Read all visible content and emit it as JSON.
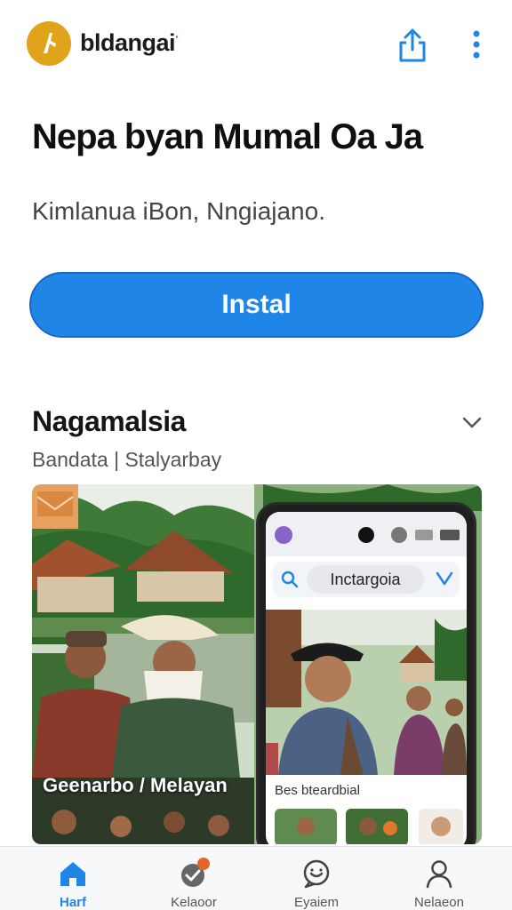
{
  "header": {
    "brand": "bldangai",
    "brand_mark": "·",
    "logo_icon": "app-logo-icon",
    "share_icon": "share-icon",
    "more_icon": "more-vertical-icon"
  },
  "app": {
    "title": "Nepa byan Mumal Oa Ja",
    "subtitle": "Kimlanua iBon, Nngiajano.",
    "install_label": "Instal"
  },
  "section": {
    "title": "Nagamalsia",
    "subtitle": "Bandata | Stalyarbay",
    "chevron_icon": "chevron-down-icon"
  },
  "gallery": {
    "caption": "Geenarbo / Melayan",
    "phone": {
      "search_text": "Inctargoia",
      "label": "Bes bteardbial"
    }
  },
  "nav": {
    "items": [
      {
        "label": "Harf",
        "icon": "home-icon",
        "active": true
      },
      {
        "label": "Kelaoor",
        "icon": "updates-icon",
        "active": false
      },
      {
        "label": "Eyaiem",
        "icon": "chat-icon",
        "active": false
      },
      {
        "label": "Nelaeon",
        "icon": "profile-icon",
        "active": false
      }
    ]
  },
  "colors": {
    "accent": "#1f86e8",
    "logo": "#e1a21c",
    "badge": "#e8642a"
  }
}
